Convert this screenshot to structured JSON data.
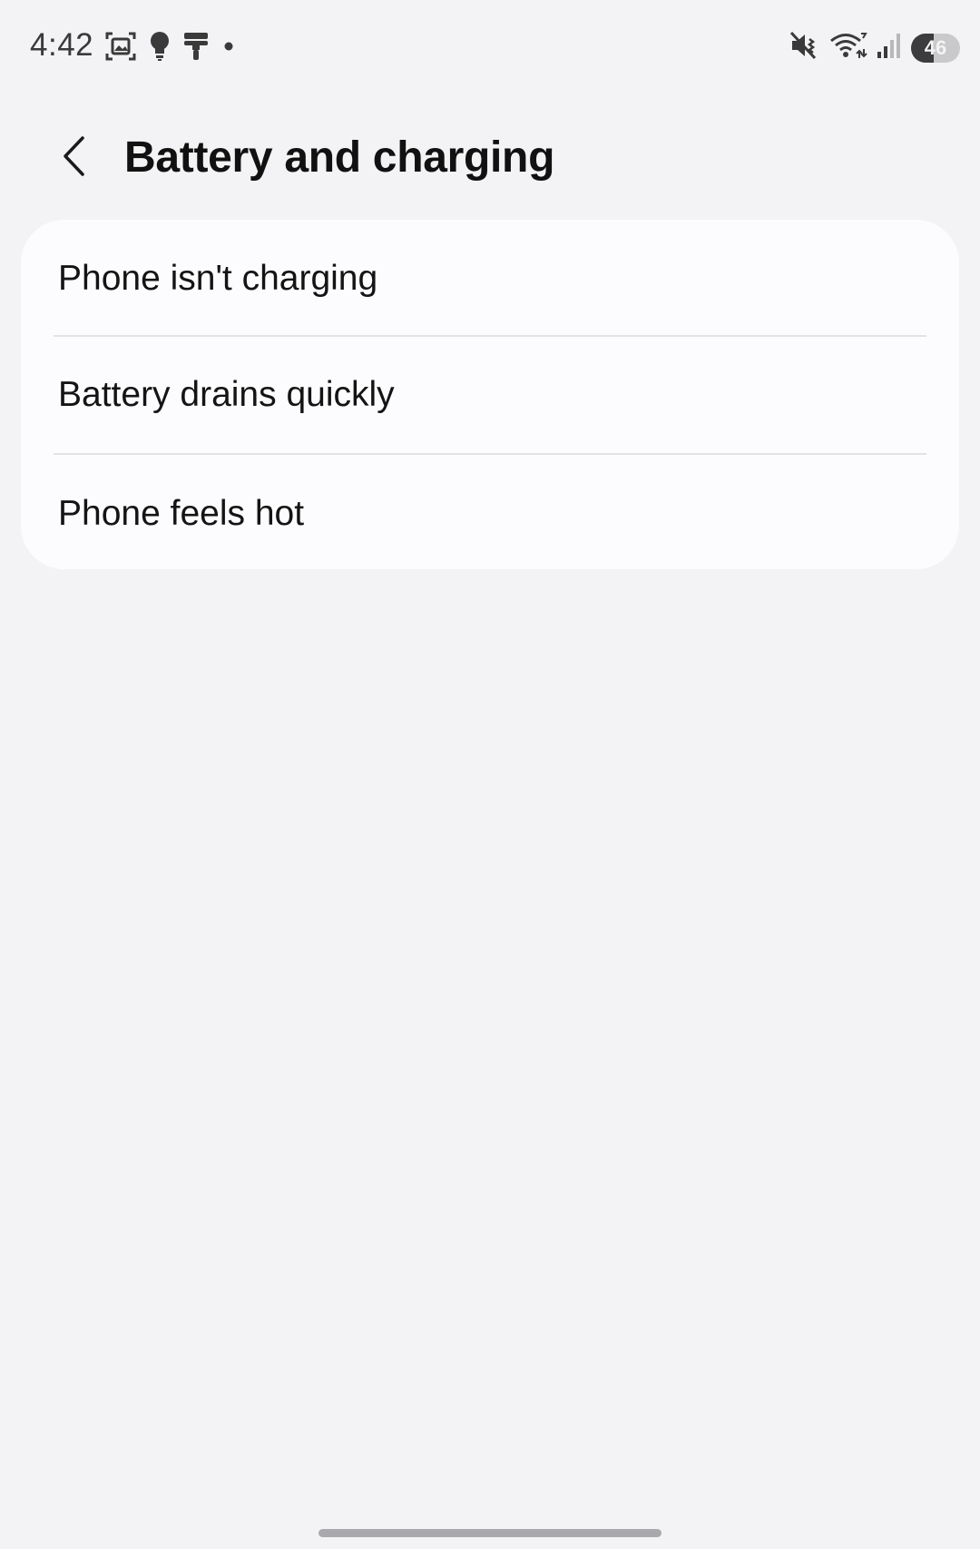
{
  "status_bar": {
    "time": "4:42",
    "battery_level": "46",
    "battery_fraction": 0.46,
    "icons_left": [
      "screenshot-icon",
      "bulb-icon",
      "paint-roller-icon",
      "dot-icon"
    ],
    "icons_right": [
      "mute-icon",
      "wifi-icon",
      "signal-icon",
      "battery-icon"
    ]
  },
  "header": {
    "title": "Battery and charging",
    "back_icon": "chevron-left-icon"
  },
  "list": {
    "items": [
      {
        "label": "Phone isn't charging"
      },
      {
        "label": "Battery drains quickly"
      },
      {
        "label": "Phone feels hot"
      }
    ]
  },
  "colors": {
    "background": "#f3f3f5",
    "card": "#fcfcfe",
    "divider": "#e3e3e6",
    "title": "#111111"
  }
}
